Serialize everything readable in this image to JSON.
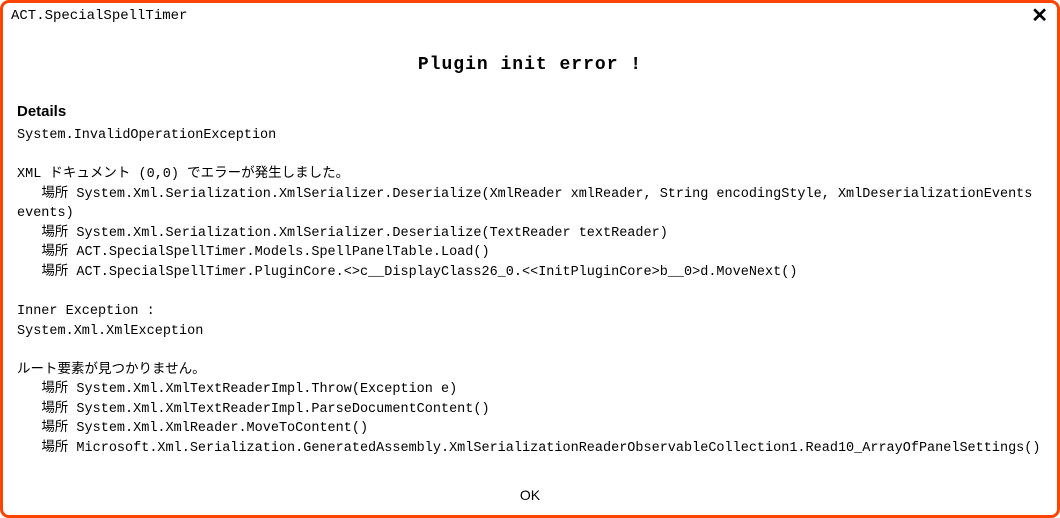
{
  "titlebar": {
    "title": "ACT.SpecialSpellTimer",
    "close_glyph": "✕"
  },
  "dialog": {
    "heading": "Plugin init error !",
    "details_label": "Details",
    "details_body": "System.InvalidOperationException\n\nXML ドキュメント (0,0) でエラーが発生しました。\n   場所 System.Xml.Serialization.XmlSerializer.Deserialize(XmlReader xmlReader, String encodingStyle, XmlDeserializationEvents events)\n   場所 System.Xml.Serialization.XmlSerializer.Deserialize(TextReader textReader)\n   場所 ACT.SpecialSpellTimer.Models.SpellPanelTable.Load()\n   場所 ACT.SpecialSpellTimer.PluginCore.<>c__DisplayClass26_0.<<InitPluginCore>b__0>d.MoveNext()\n\nInner Exception :\nSystem.Xml.XmlException\n\nルート要素が見つかりません。\n   場所 System.Xml.XmlTextReaderImpl.Throw(Exception e)\n   場所 System.Xml.XmlTextReaderImpl.ParseDocumentContent()\n   場所 System.Xml.XmlReader.MoveToContent()\n   場所 Microsoft.Xml.Serialization.GeneratedAssembly.XmlSerializationReaderObservableCollection1.Read10_ArrayOfPanelSettings()"
  },
  "footer": {
    "ok_label": "OK"
  },
  "colors": {
    "border": "#ff4400"
  }
}
